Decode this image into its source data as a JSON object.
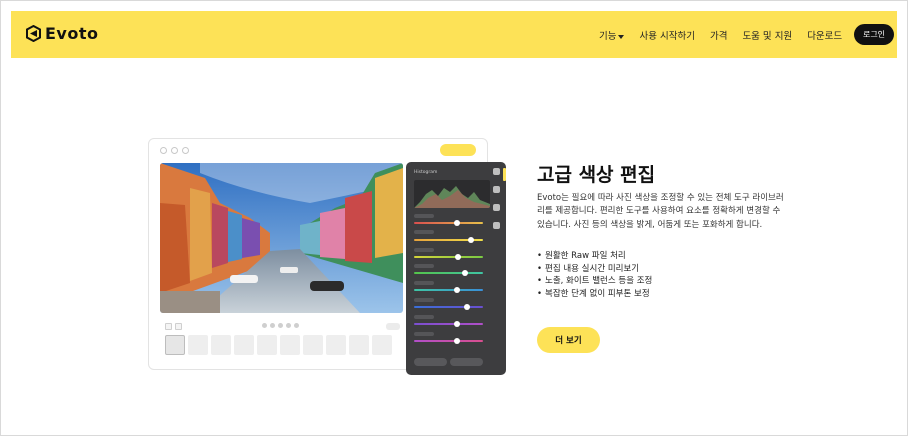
{
  "nav": {
    "logo_text": "Evoto",
    "menu": [
      "기능",
      "사용 시작하기",
      "가격",
      "도움 및 지원",
      "다운로드"
    ],
    "login_label": "로그인",
    "accent_color": "#fde257"
  },
  "mockup": {
    "panel_title": "Histogram",
    "icons": [
      "palette-icon",
      "drop-icon",
      "image-icon",
      "crop-icon"
    ]
  },
  "section": {
    "heading": "고급 색상 편집",
    "description": "Evoto는 필요에 따라 사진 색상을 조정할 수 있는 전체 도구 라이브러리를 제공합니다. 편리한 도구를 사용하여 요소를 정확하게 변경할 수 있습니다. 사진 등의 색상을 밝게, 어둡게 또는 포화하게 합니다.",
    "bullets": [
      "원활한 Raw 파일 처리",
      "편집 내용 실시간 미리보기",
      "노출, 화이트 밸런스 등을 조정",
      "복잡한 단계 없이 피부톤 보정"
    ],
    "button_label": "더 보기"
  }
}
